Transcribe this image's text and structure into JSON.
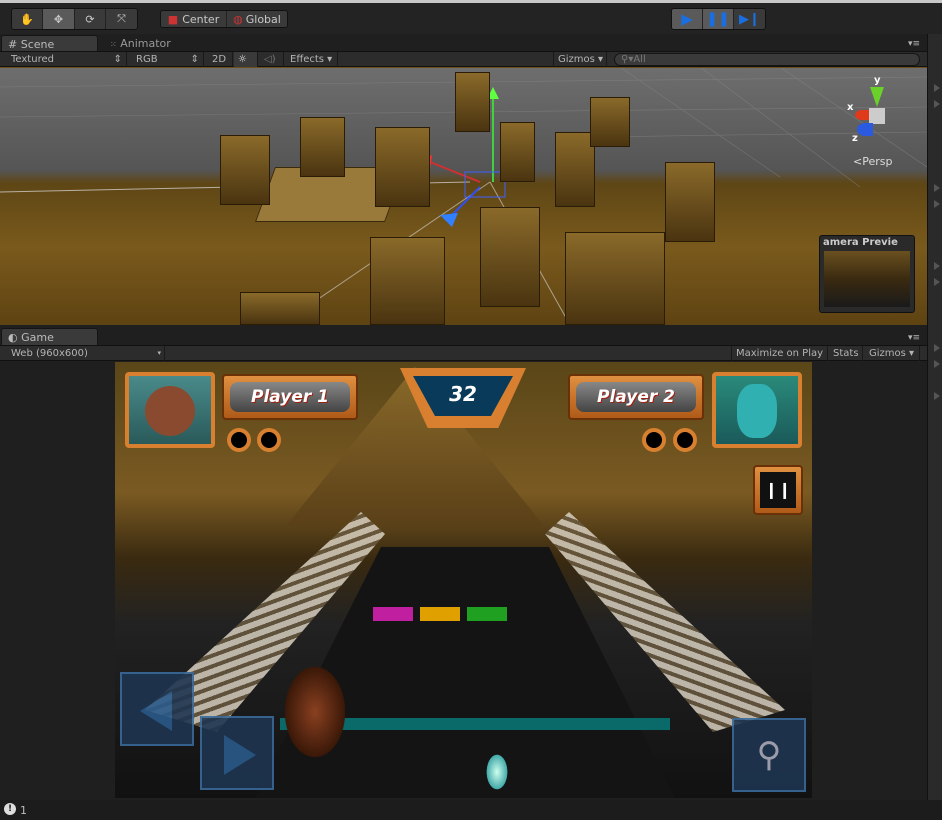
{
  "toolbar": {
    "tools": [
      {
        "icon": "hand-icon"
      },
      {
        "icon": "move-icon",
        "active": true
      },
      {
        "icon": "rotate-icon"
      },
      {
        "icon": "scale-icon"
      }
    ],
    "pivot_label": "Center",
    "space_label": "Global",
    "play": {
      "icon": "play-icon",
      "active": true
    },
    "pause": {
      "icon": "pause-icon",
      "active": true
    },
    "step": {
      "icon": "step-icon"
    },
    "accent": "#1a6fe0"
  },
  "scene_panel": {
    "tabs": [
      {
        "label": "Scene",
        "icon": "grid-icon"
      },
      {
        "label": "Animator",
        "icon": "animator-icon"
      }
    ],
    "render_mode": "Textured",
    "channel": "RGB",
    "mode_2d": "2D",
    "effects": "Effects",
    "gizmos": "Gizmos",
    "search_placeholder": "All",
    "gizmo_axes": {
      "x": "x",
      "y": "y",
      "z": "z"
    },
    "projection": "Persp",
    "camera_preview_title": "amera Previe"
  },
  "game_panel": {
    "tab": "Game",
    "resolution": "Web (960x600)",
    "maximize": "Maximize on Play",
    "stats": "Stats",
    "gizmos": "Gizmos",
    "hud": {
      "player1": "Player 1",
      "player2": "Player 2",
      "timer": "32",
      "pause_icon": "pause-icon"
    },
    "tile_colors": [
      "#c020a0",
      "#e0a000",
      "#20a020"
    ]
  },
  "status_bar": {
    "count": "1",
    "icon": "info-icon"
  }
}
